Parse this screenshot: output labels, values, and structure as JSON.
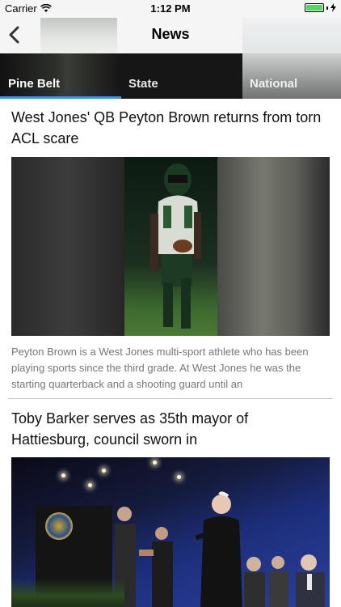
{
  "status_bar": {
    "carrier": "Carrier",
    "time": "1:12 PM",
    "wifi_icon": "wifi-icon",
    "battery_icon": "battery-icon",
    "charging_icon": "charging-bolt-icon",
    "battery_level": 1.0,
    "battery_color": "#4cd964"
  },
  "nav": {
    "title": "News",
    "back_icon": "chevron-left-icon"
  },
  "tabs": [
    {
      "label": "Pine Belt",
      "selected": true
    },
    {
      "label": "State",
      "selected": false
    },
    {
      "label": "National",
      "selected": false
    }
  ],
  "accent_color": "#3d8fe0",
  "articles": [
    {
      "headline": "West Jones' QB Peyton Brown returns from torn ACL scare",
      "summary": "Peyton Brown is a West Jones multi-sport athlete who has been playing sports since the third grade. At West Jones he was the starting quarterback and a shooting guard until an"
    },
    {
      "headline": "Toby Barker serves as 35th mayor of Hattiesburg, council sworn in"
    }
  ]
}
